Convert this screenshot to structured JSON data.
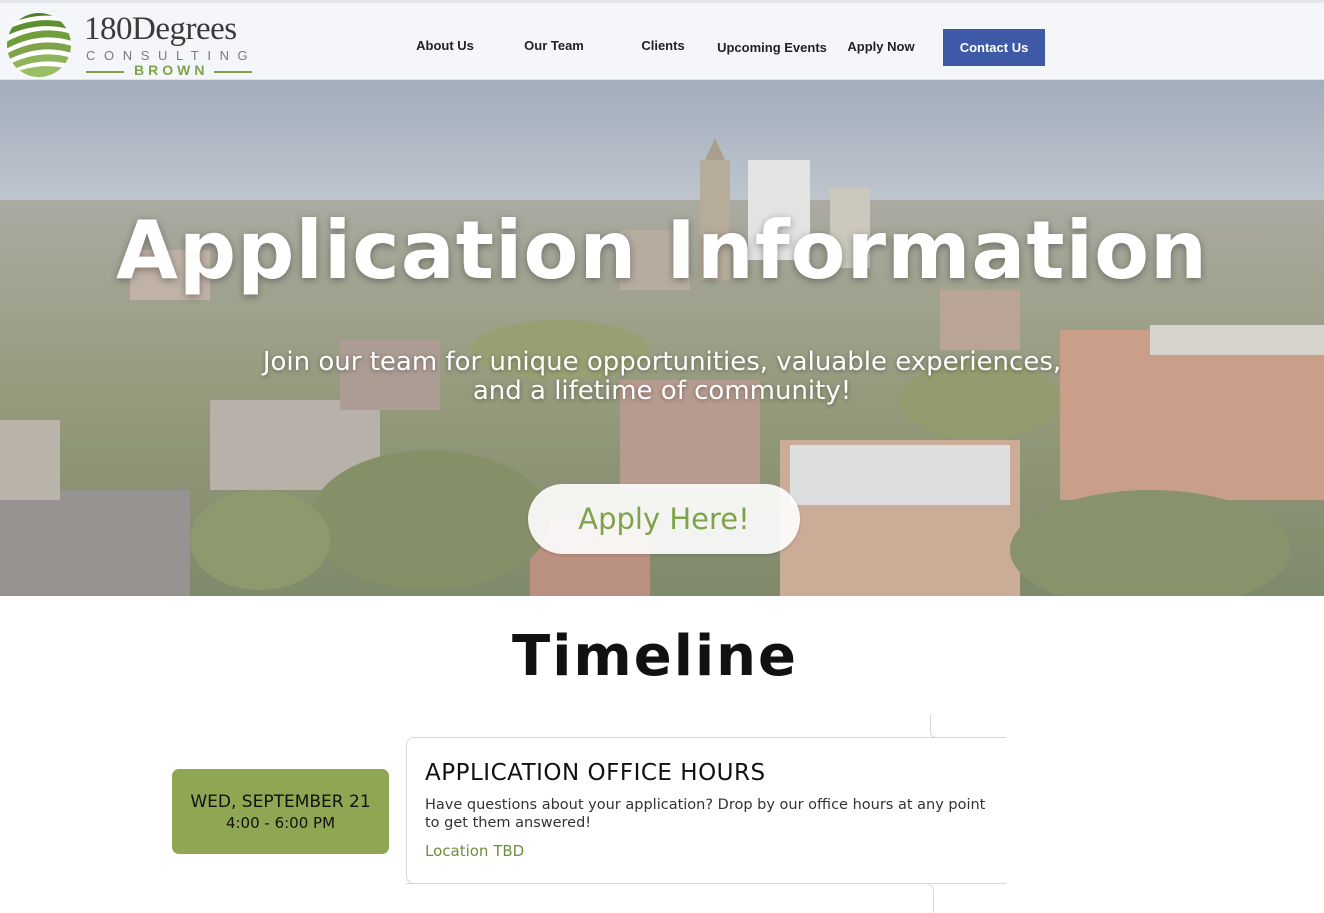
{
  "brand": {
    "name": "180Degrees",
    "tagline": "CONSULTING",
    "school": "BROWN",
    "colors": {
      "green": "#7fa34a",
      "navy": "#3e5aa7",
      "badge": "#8fa653"
    }
  },
  "nav": {
    "items": [
      {
        "label": "About Us"
      },
      {
        "label": "Our Team"
      },
      {
        "label": "Clients"
      },
      {
        "label": "Upcoming Events"
      },
      {
        "label": "Apply Now"
      }
    ],
    "contact_label": "Contact Us"
  },
  "hero": {
    "title": "Application Information",
    "subtitle": "Join our team for unique opportunities, valuable experiences, and a lifetime of community!",
    "cta_label": "Apply Here!"
  },
  "timeline": {
    "title": "Timeline",
    "events": [
      {
        "day": "WED, SEPTEMBER 21",
        "time": "4:00 - 6:00 PM",
        "title": "APPLICATION OFFICE HOURS",
        "description": "Have questions about your application? Drop by our office hours at any point to get them answered!",
        "location": "Location TBD"
      }
    ]
  }
}
